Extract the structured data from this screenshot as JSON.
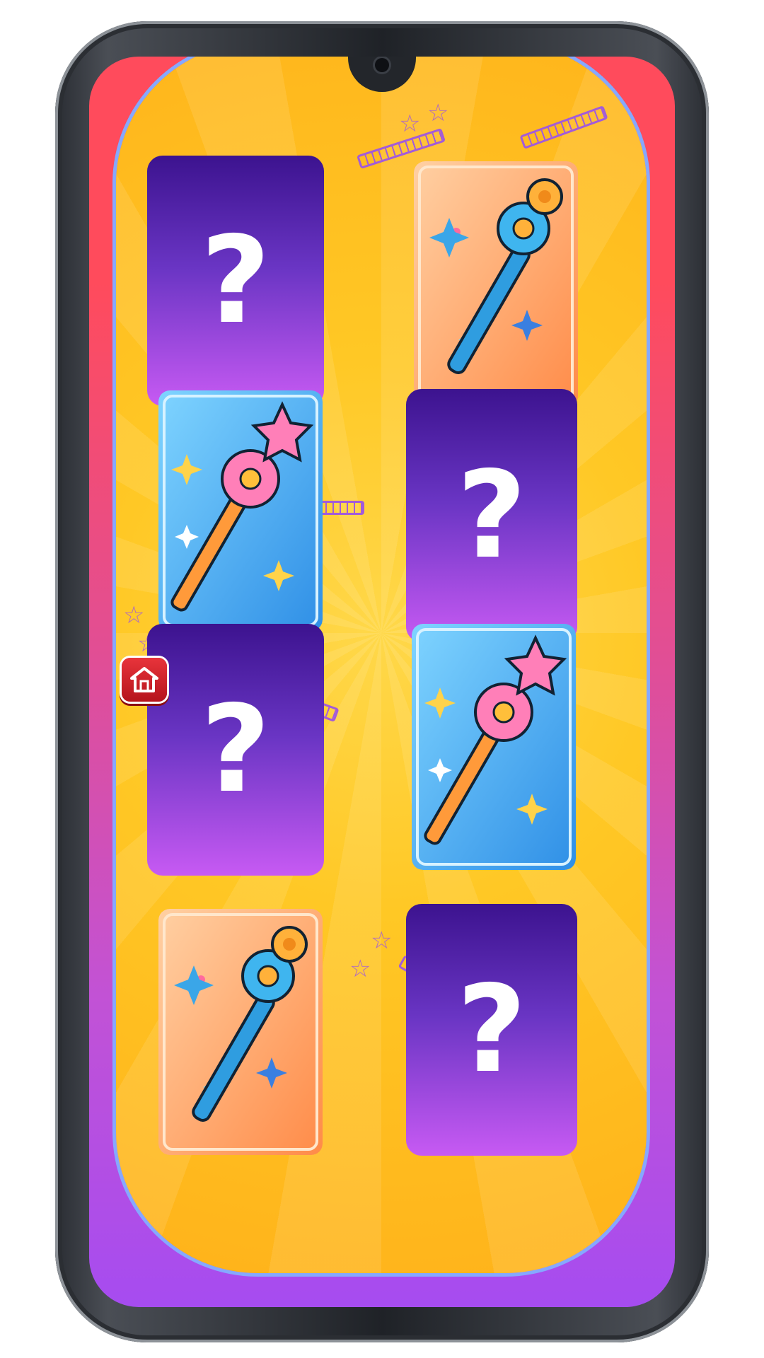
{
  "game": {
    "home_button_icon": "home-icon",
    "hidden_symbol": "?",
    "colors": {
      "board_background": "#ffc825",
      "card_back_top": "#3c138f",
      "card_back_bottom": "#c75af3",
      "outer_gradient_top": "#ff4b5c",
      "outer_gradient_bottom": "#a64cf0",
      "home_button": "#d5222b"
    },
    "cards": [
      {
        "state": "hidden"
      },
      {
        "state": "revealed",
        "icon": "blue-wand-orange-card-icon"
      },
      {
        "state": "revealed",
        "icon": "pink-star-wand-blue-card-icon"
      },
      {
        "state": "hidden"
      },
      {
        "state": "hidden"
      },
      {
        "state": "revealed",
        "icon": "pink-star-wand-blue-card-icon"
      },
      {
        "state": "revealed",
        "icon": "blue-wand-orange-card-icon"
      },
      {
        "state": "hidden"
      }
    ]
  }
}
